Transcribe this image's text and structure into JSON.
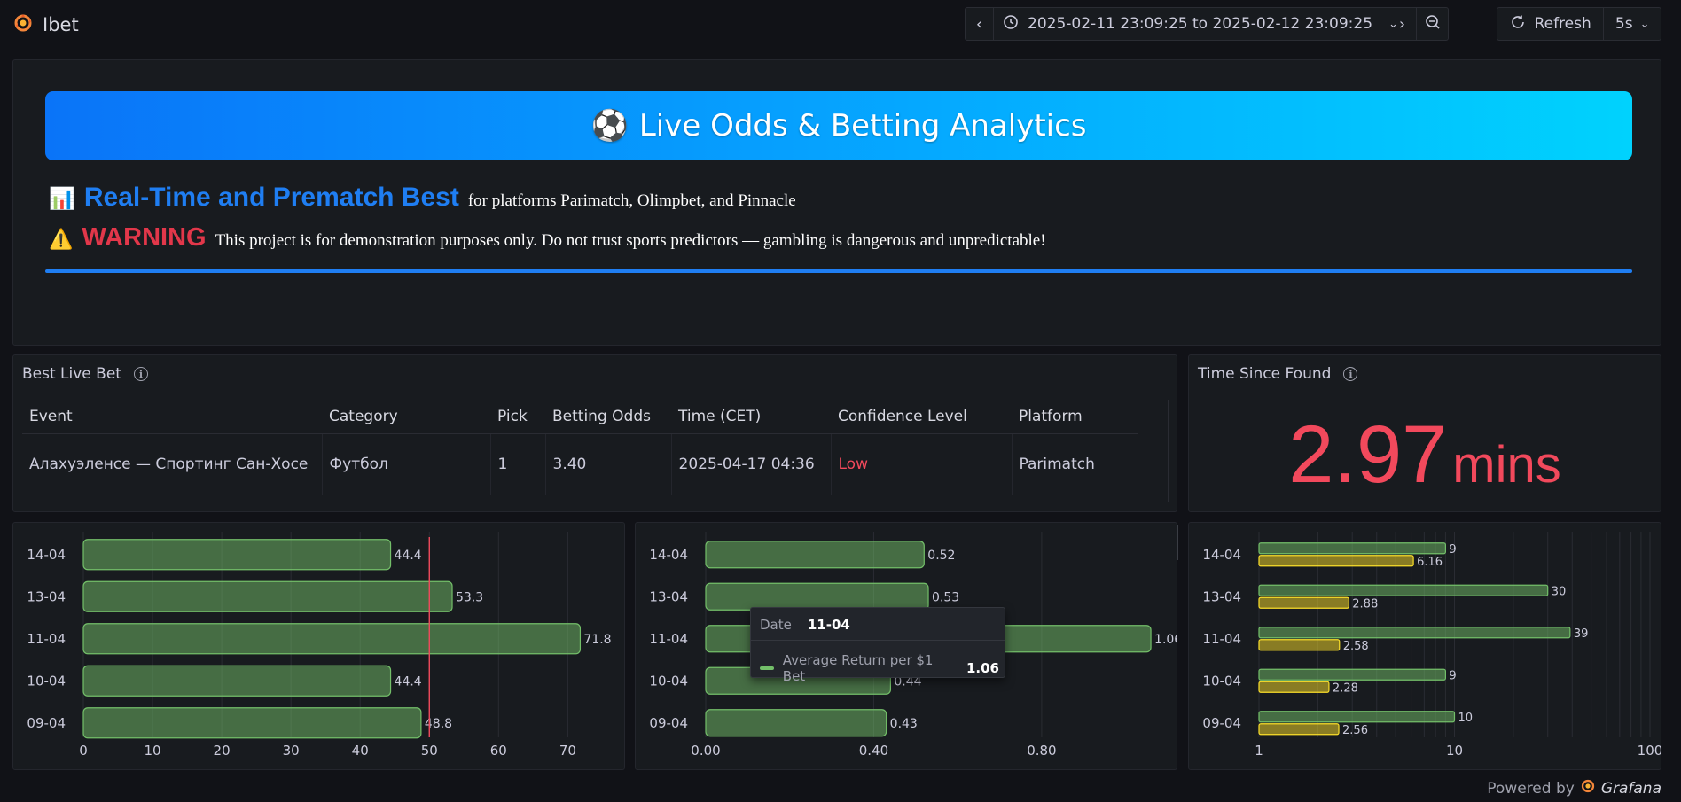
{
  "app": {
    "title": "Ibet"
  },
  "toolbar": {
    "time_range": "2025-02-11 23:09:25 to 2025-02-12 23:09:25",
    "refresh_label": "Refresh",
    "refresh_interval": "5s"
  },
  "banner": {
    "emoji": "⚽",
    "title": "Live Odds & Betting Analytics",
    "line1_icon": "📊",
    "line1_heading": "Real-Time and Prematch Best",
    "line1_text": "for platforms Parimatch, Olimpbet, and Pinnacle",
    "line2_icon": "⚠️",
    "line2_heading": "WARNING",
    "line2_text": "This project is for demonstration purposes only. Do not trust sports predictors — gambling is dangerous and unpredictable!"
  },
  "best_live_bet": {
    "title": "Best Live Bet",
    "columns": [
      "Event",
      "Category",
      "Pick",
      "Betting Odds",
      "Time (CET)",
      "Confidence Level",
      "Platform"
    ],
    "row": [
      "Алахуэленсе — Спортинг Сан-Хосе",
      "Футбол",
      "1",
      "3.40",
      "2025-04-17 04:36",
      "Low",
      "Parimatch"
    ]
  },
  "time_since_found": {
    "title": "Time Since Found",
    "value": "2.97",
    "unit": "mins"
  },
  "chart_data": [
    {
      "type": "bar",
      "orientation": "horizontal",
      "categories": [
        "14-04",
        "13-04",
        "11-04",
        "10-04",
        "09-04"
      ],
      "series": [
        {
          "values": [
            44.4,
            53.3,
            71.8,
            44.4,
            48.8
          ]
        }
      ],
      "xticks": [
        "0",
        "10",
        "20",
        "30",
        "40",
        "50",
        "60",
        "70"
      ],
      "xlim": [
        0,
        77
      ],
      "threshold": 50,
      "grid": true,
      "color": "#73bf69"
    },
    {
      "type": "bar",
      "orientation": "horizontal",
      "categories": [
        "14-04",
        "13-04",
        "11-04",
        "10-04",
        "09-04"
      ],
      "series": [
        {
          "name": "Average Return per $1 Bet",
          "values": [
            0.52,
            0.53,
            1.06,
            0.44,
            0.43
          ]
        }
      ],
      "xticks": [
        "0.00",
        "0.40",
        "0.80"
      ],
      "xlim": [
        0,
        1.1
      ],
      "grid": true,
      "color": "#73bf69"
    },
    {
      "type": "bar",
      "orientation": "horizontal",
      "scale": "log",
      "categories": [
        "14-04",
        "13-04",
        "11-04",
        "10-04",
        "09-04"
      ],
      "series": [
        {
          "values": [
            9,
            30,
            39,
            9,
            10
          ],
          "color": "#73bf69"
        },
        {
          "values": [
            6.16,
            2.88,
            2.58,
            2.28,
            2.56
          ],
          "color": "#fade2a"
        }
      ],
      "xticks": [
        "1",
        "10",
        "100"
      ],
      "xlim": [
        1,
        100
      ],
      "grid": true
    }
  ],
  "tooltip": {
    "date_label": "Date",
    "date_value": "11-04",
    "series_label": "Average Return per $1 Bet",
    "series_value": "1.06"
  },
  "footer": {
    "powered_by": "Powered by",
    "brand": "Grafana"
  }
}
